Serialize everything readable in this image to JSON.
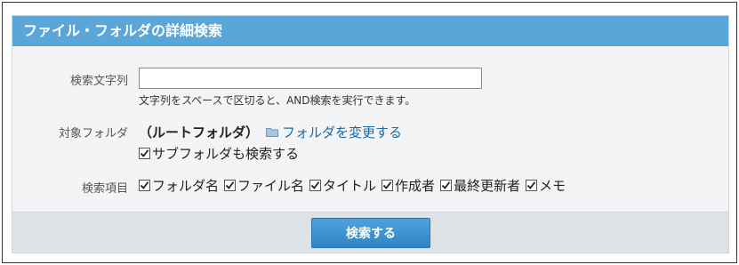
{
  "header": {
    "title": "ファイル・フォルダの詳細検索"
  },
  "keyword": {
    "label": "検索文字列",
    "value": "",
    "hint": "文字列をスペースで区切ると、AND検索を実行できます。"
  },
  "folder": {
    "label": "対象フォルダ",
    "name": "（ルートフォルダ）",
    "change_link": "フォルダを変更する",
    "include_subfolders": {
      "label": "サブフォルダも検索する",
      "checked": true
    }
  },
  "items": {
    "label": "検索項目",
    "options": [
      {
        "label": "フォルダ名",
        "checked": true
      },
      {
        "label": "ファイル名",
        "checked": true
      },
      {
        "label": "タイトル",
        "checked": true
      },
      {
        "label": "作成者",
        "checked": true
      },
      {
        "label": "最終更新者",
        "checked": true
      },
      {
        "label": "メモ",
        "checked": true
      }
    ]
  },
  "footer": {
    "search_button": "検索する"
  },
  "colors": {
    "header": "#5ba6d8",
    "link": "#1a6aa8",
    "button": "#3a93d3"
  }
}
